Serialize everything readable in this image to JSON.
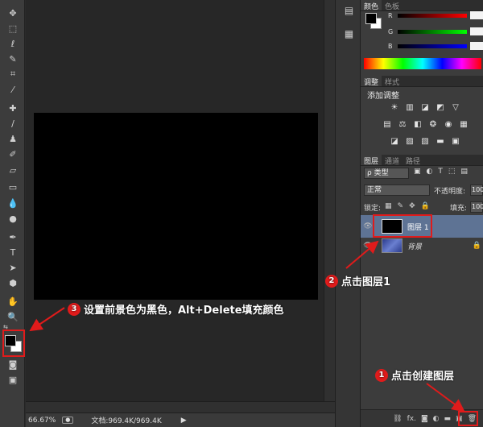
{
  "panels": {
    "color_tabs": [
      "颜色",
      "色板"
    ],
    "rgb_labels": [
      "R",
      "G",
      "B"
    ],
    "adjust_tabs": [
      "调整",
      "样式"
    ],
    "adjust_title": "添加调整",
    "layer_tabs": [
      "图层",
      "通道",
      "路径"
    ],
    "filter_label": "ρ 类型",
    "blend_mode": "正常",
    "opacity_label": "不透明度:",
    "opacity_value": "100",
    "lock_label": "锁定:",
    "fill_label": "填充:",
    "fill_value": "100",
    "layers": [
      {
        "name": "图层 1"
      },
      {
        "name": "背景"
      }
    ],
    "bottom_icons": [
      "link-icon",
      "fx-icon",
      "mask-icon",
      "adjustment-icon",
      "folder-icon",
      "new-layer-icon"
    ]
  },
  "status": {
    "zoom": "66.67%",
    "doc_info": "文档:969.4K/969.4K"
  },
  "annotations": {
    "step1_num": "1",
    "step1": "点击创建图层",
    "step2_num": "2",
    "step2": "点击图层1",
    "step3_num": "3",
    "step3": "设置前景色为黑色，Alt+Delete填充颜色"
  },
  "colors": {
    "accent": "#e01b1b",
    "selected_layer": "#5e7394",
    "canvas": "#000000"
  }
}
